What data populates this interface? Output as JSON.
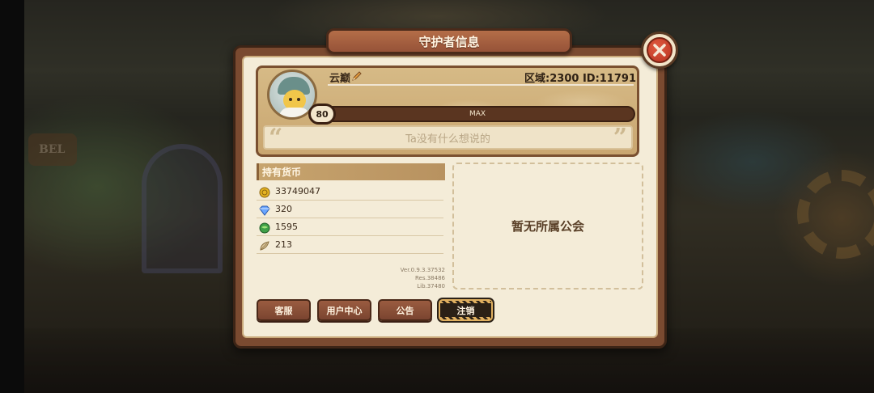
{
  "background": {
    "sign_text": "BEL"
  },
  "dialog": {
    "title": "守护者信息",
    "close_icon": "close-x-icon"
  },
  "profile": {
    "name": "云巅",
    "edit_icon": "pencil-icon",
    "region_id": "区域:2300 ID:11791",
    "level": "80",
    "level_bar_text": "MAX",
    "level_progress": 1.0,
    "motto": "Ta没有什么想说的",
    "quote_open": "“",
    "quote_close": "”"
  },
  "currency": {
    "header": "持有货币",
    "items": [
      {
        "icon": "gold-coin-icon",
        "value": "33749047"
      },
      {
        "icon": "diamond-gem-icon",
        "value": "320"
      },
      {
        "icon": "green-orb-icon",
        "value": "1595"
      },
      {
        "icon": "feather-leaf-icon",
        "value": "213"
      }
    ]
  },
  "version": {
    "ver": "Ver.0.9.3.37532",
    "res": "Res.38486",
    "lib": "Lib.37480"
  },
  "guild": {
    "empty_text": "暂无所属公会"
  },
  "buttons": {
    "service": "客服",
    "user_center": "用户中心",
    "notice": "公告",
    "logout": "注销"
  },
  "colors": {
    "panel_wood": "#7a4a30",
    "panel_paper": "#f4ecd8",
    "button_brown": "#8a5038",
    "accent_gold": "#e0b060",
    "close_red": "#c83a26"
  }
}
